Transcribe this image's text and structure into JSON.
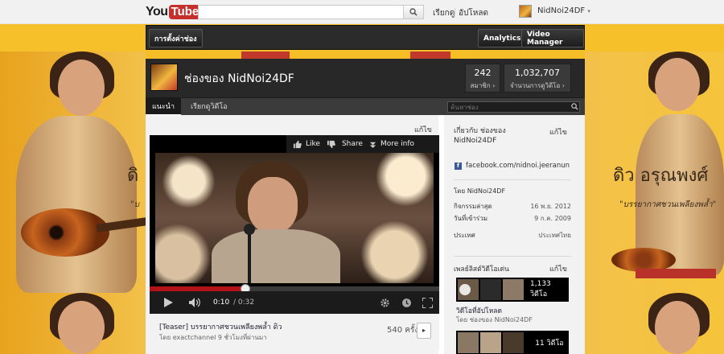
{
  "masthead": {
    "logo_you": "You",
    "logo_tube": "Tube",
    "search_placeholder": "",
    "browse": "เรียกดู",
    "upload": "อัปโหลด",
    "user_name": "NidNoi24DF"
  },
  "channel_bar": {
    "settings": "การตั้งค่าช่อง",
    "analytics": "Analytics",
    "video_manager": "Video Manager"
  },
  "background": {
    "title": "ดิว อรุณพงศ์",
    "title_left": "ดิ",
    "subtitle": "\"บรรยากาศชวนเพลียงพล้ำ\"",
    "subtitle_left": "\"บ"
  },
  "channel": {
    "title": "ช่องของ NidNoi24DF",
    "subscribers": "242",
    "subscribers_label": "สมาชิก ›",
    "views": "1,032,707",
    "views_label": "จำนวนการดูวิดีโอ ›",
    "tabs": [
      "แนะนำ",
      "เรียกดูวิดีโอ"
    ],
    "search_placeholder": "ค้นหาช่อง"
  },
  "featured": {
    "edit": "แก้ไข",
    "player": {
      "like": "Like",
      "share": "Share",
      "more_info": "More info",
      "time_current": "0:10",
      "time_total": "/ 0:32",
      "progress": 0.33
    },
    "video_title": "[Teaser] บรรยากาศชวนเพลียงพล้ำ ดิว",
    "video_meta": "โดย exactchannel 9 ชั่วโมงที่ผ่านมา",
    "view_count": "540 ครั้ง",
    "share_small": "▸"
  },
  "sidebar": {
    "about_heading": "เกี่ยวกับ ช่องของ NidNoi24DF",
    "edit": "แก้ไข",
    "facebook": "facebook.com/nidnoi.jeeranun",
    "by": "โดย NidNoi24DF",
    "rows": [
      {
        "label": "กิจกรรมล่าสุด",
        "value": "16 พ.ย. 2012"
      },
      {
        "label": "วันที่เข้าร่วม",
        "value": "9 ก.ค. 2009"
      },
      {
        "label": "ประเทศ",
        "value": "ประเทศไทย"
      }
    ],
    "playlist_heading": "เพลย์ลิสต์วิดีโอเด่น",
    "playlist_edit": "แก้ไข",
    "playlists": [
      {
        "count": "1,133 วิดีโอ",
        "title": "วิดีโอที่อัปโหลด",
        "by": "โดย ช่องของ NidNoi24DF"
      },
      {
        "count": "11 วิดีโอ"
      }
    ]
  },
  "colors": {
    "accent_red": "#c4302b",
    "progress_red": "#b31217",
    "background_yellow": "#f5bd26"
  }
}
